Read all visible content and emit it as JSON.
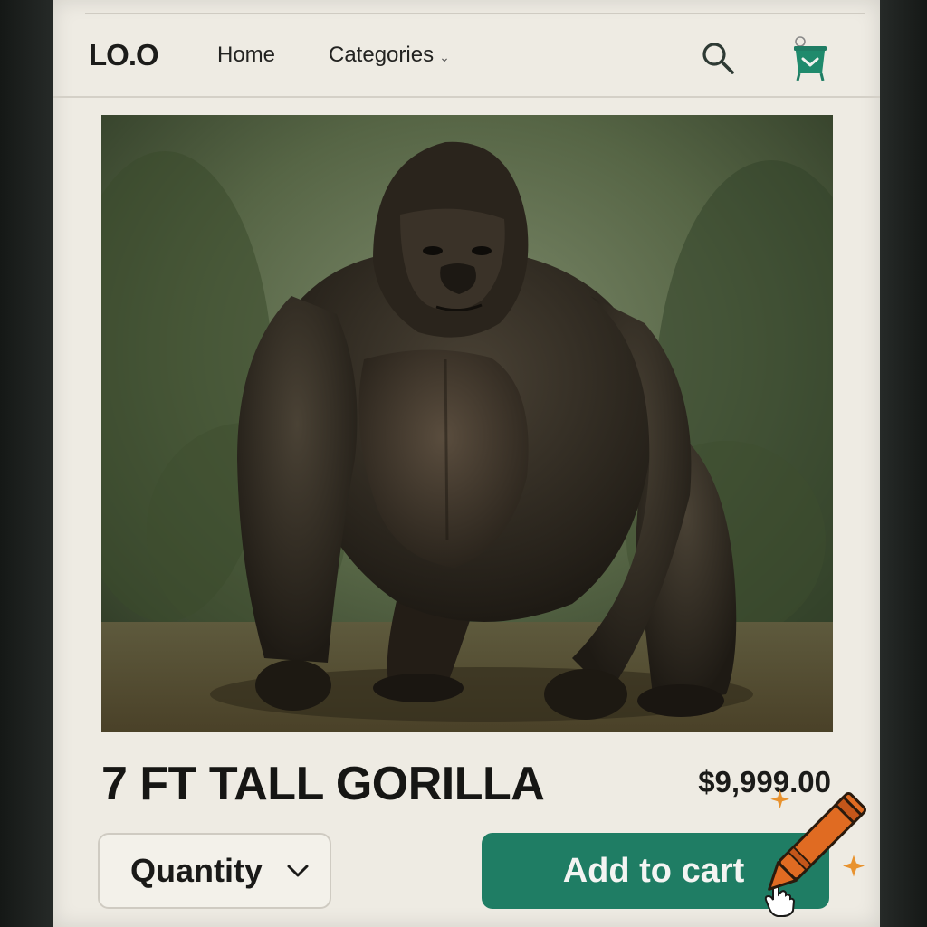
{
  "header": {
    "logo": "LO.O",
    "nav": [
      {
        "label": "Home"
      },
      {
        "label": "Categories"
      }
    ],
    "icons": [
      "search-icon",
      "shopping-cart-icon"
    ]
  },
  "product": {
    "title": "7 FT TALL GORILLA",
    "price": "$9,999.00",
    "image_subject": "gorilla"
  },
  "actions": {
    "quantity_label": "Quantity",
    "add_to_cart_label": "Add to cart"
  },
  "colors": {
    "accent": "#1f7d64",
    "crayon": "#e06b22",
    "background": "#eeebe3"
  }
}
